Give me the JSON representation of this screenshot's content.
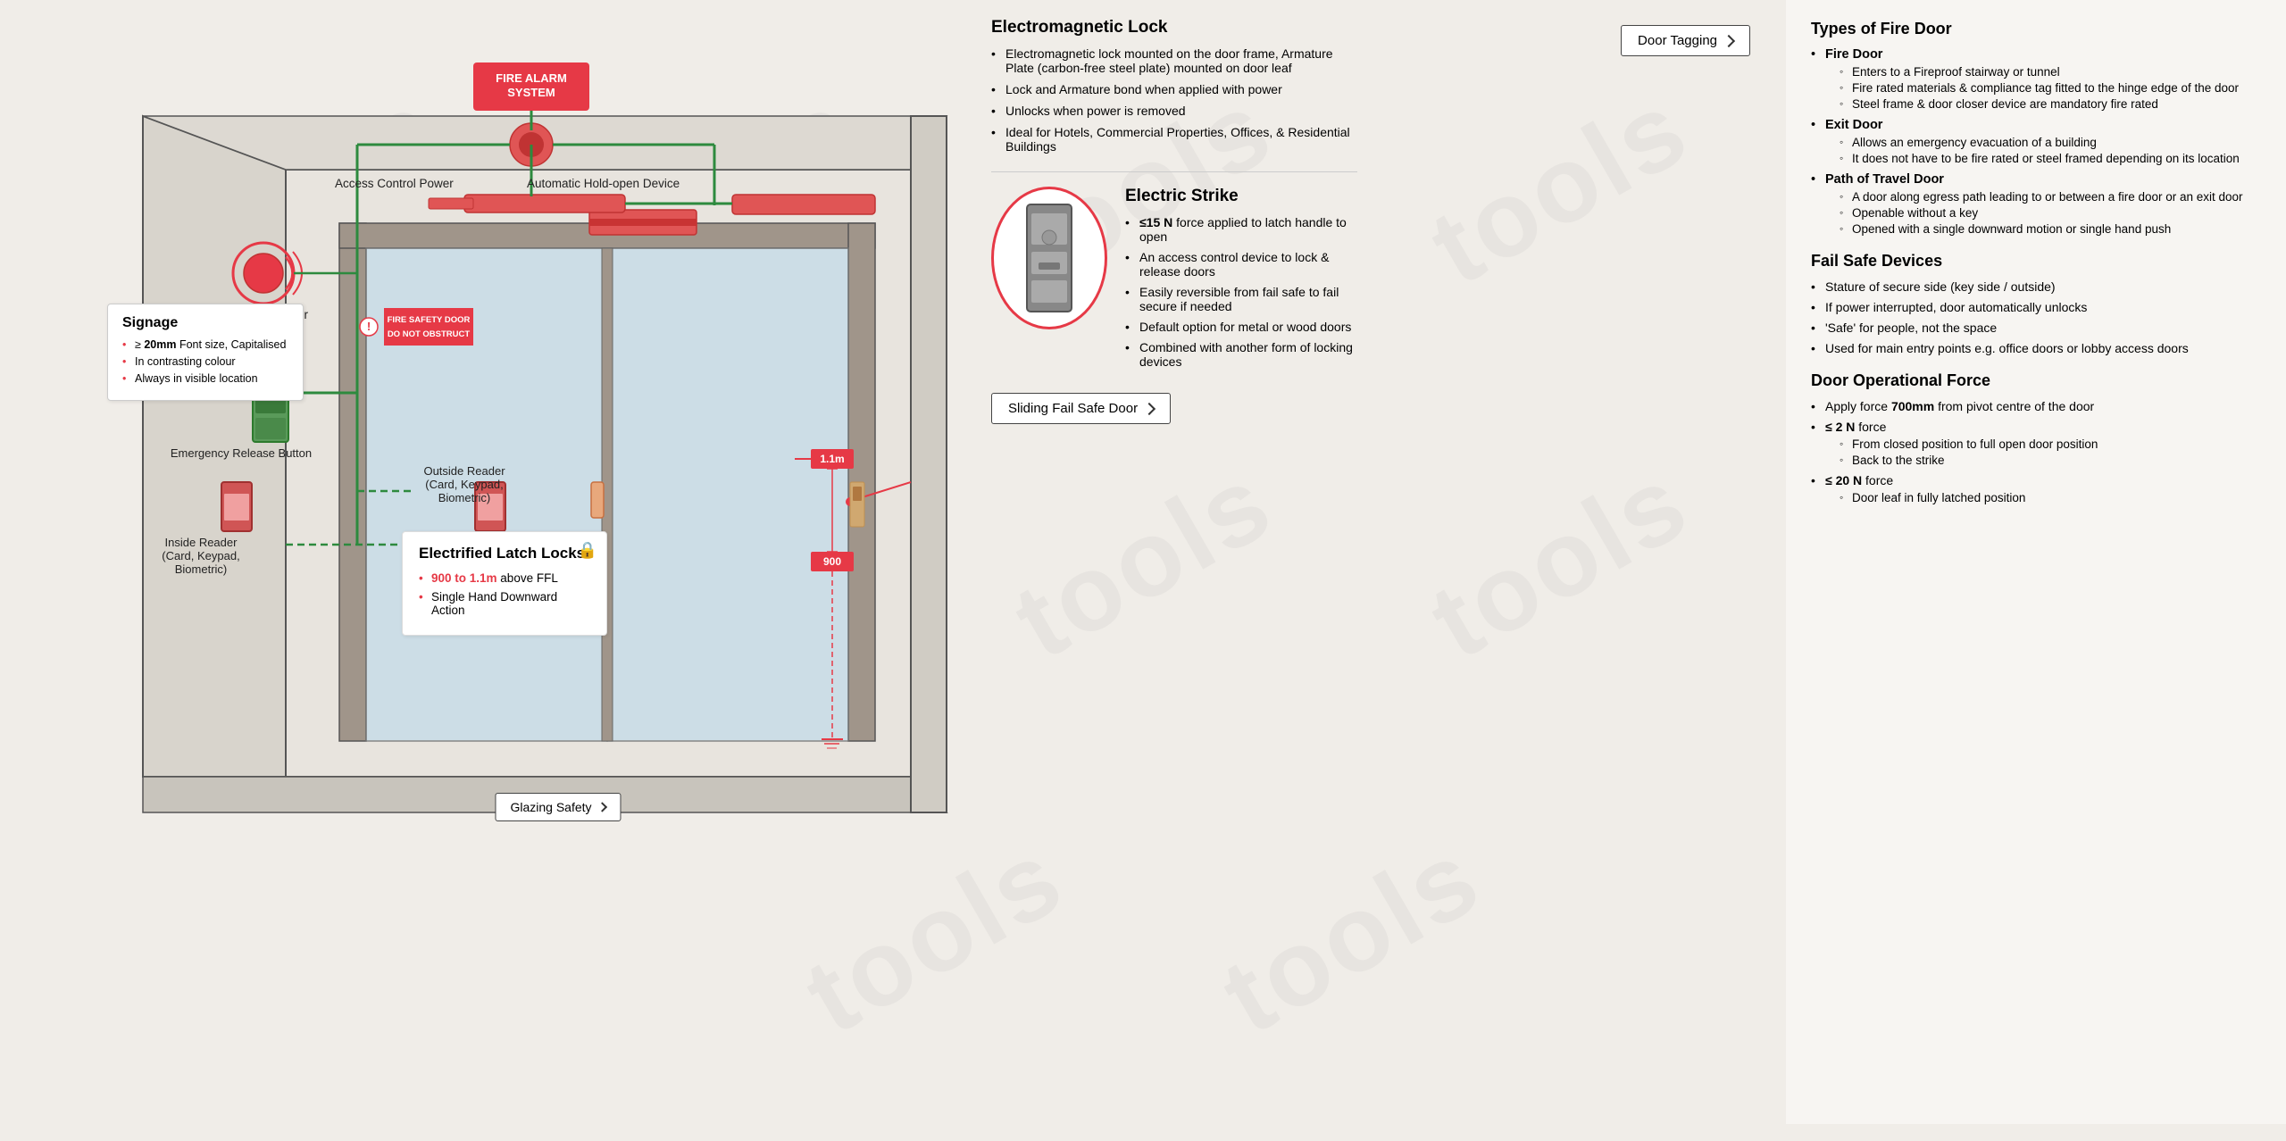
{
  "watermark": {
    "text": "tools"
  },
  "header": {
    "door_tagging_btn": "Door Tagging"
  },
  "fire_alarm": {
    "label": "FIRE ALARM\nSYSTEM"
  },
  "automatic_hold_open": {
    "label": "Automatic Hold-open Device"
  },
  "access_control_power": {
    "label": "Access Control Power"
  },
  "alarm_sounder": {
    "label": "Alarm Sounder"
  },
  "emergency_release": {
    "label": "Emergency Release Button"
  },
  "inside_reader": {
    "label": "Inside Reader\n(Card, Keypad,\nBiometric)"
  },
  "outside_reader": {
    "label": "Outside Reader\n(Card, Keypad,\nBiometric)"
  },
  "signage": {
    "title": "Signage",
    "items": [
      "≥ 20mm Font size, Capitalised",
      "In contrasting colour",
      "Always in visible location"
    ]
  },
  "door_sign": {
    "line1": "FIRE SAFETY DOOR",
    "line2": "DO NOT OBSTRUCT"
  },
  "elec_latch": {
    "title": "Electrified Latch Locks",
    "items": [
      "900 to 1.1m above FFL",
      "Single Hand Downward Action"
    ],
    "height_label": "900 to 1.1m",
    "action_label": "Single Hand Downward"
  },
  "measurements": {
    "top": "1.1m",
    "bottom": "900"
  },
  "glazing_btn": "Glazing Safety",
  "em_lock": {
    "title": "Electromagnetic Lock",
    "items": [
      "Electromagnetic lock mounted on the door frame, Armature Plate (carbon-free steel plate) mounted on door leaf",
      "Lock and Armature bond when applied with power",
      "Unlocks when power is removed",
      "Ideal for Hotels, Commercial Properties, Offices, & Residential Buildings"
    ]
  },
  "types_of_fire_door": {
    "title": "Types of Fire Door",
    "items": [
      {
        "label": "Fire Door",
        "sub": [
          "Enters to a Fireproof stairway or tunnel",
          "Fire rated materials & compliance tag fitted to the hinge edge of the door",
          "Steel frame & door closer device are mandatory fire rated"
        ]
      },
      {
        "label": "Exit Door",
        "sub": [
          "Allows an emergency evacuation of a building",
          "It does not have to be fire rated or steel framed depending on its location"
        ]
      },
      {
        "label": "Path of Travel Door",
        "sub": [
          "A door along egress path leading to or between a fire door or an exit door",
          "Openable without a key",
          "Opened with a single downward motion or single hand push"
        ]
      }
    ]
  },
  "fail_safe": {
    "title": "Fail Safe Devices",
    "items": [
      "Stature of secure side (key side / outside)",
      "If power interrupted, door automatically unlocks",
      "'Safe' for people, not the space",
      "Used for main entry points e.g. office doors or lobby access doors"
    ]
  },
  "door_operational_force": {
    "title": "Door Operational Force",
    "items": [
      {
        "label": "Apply force 700mm from pivot centre of the door",
        "bold": "700mm",
        "sub": []
      },
      {
        "label": "≤ 2 N force",
        "bold": "≤ 2 N",
        "sub": [
          "From closed position to full open door position",
          "Back to the strike"
        ]
      },
      {
        "label": "≤ 20 N force",
        "bold": "≤ 20 N",
        "sub": [
          "Door leaf in fully latched position"
        ]
      }
    ]
  },
  "electric_strike": {
    "title": "Electric Strike",
    "items": [
      "≤15 N  force applied to latch handle to open",
      "An access control device to lock & release doors",
      "Easily reversible from fail safe to fail secure if needed",
      "Default option for metal or wood doors",
      "Combined with another form of locking devices"
    ]
  },
  "sliding_btn": "Sliding Fail Safe Door"
}
